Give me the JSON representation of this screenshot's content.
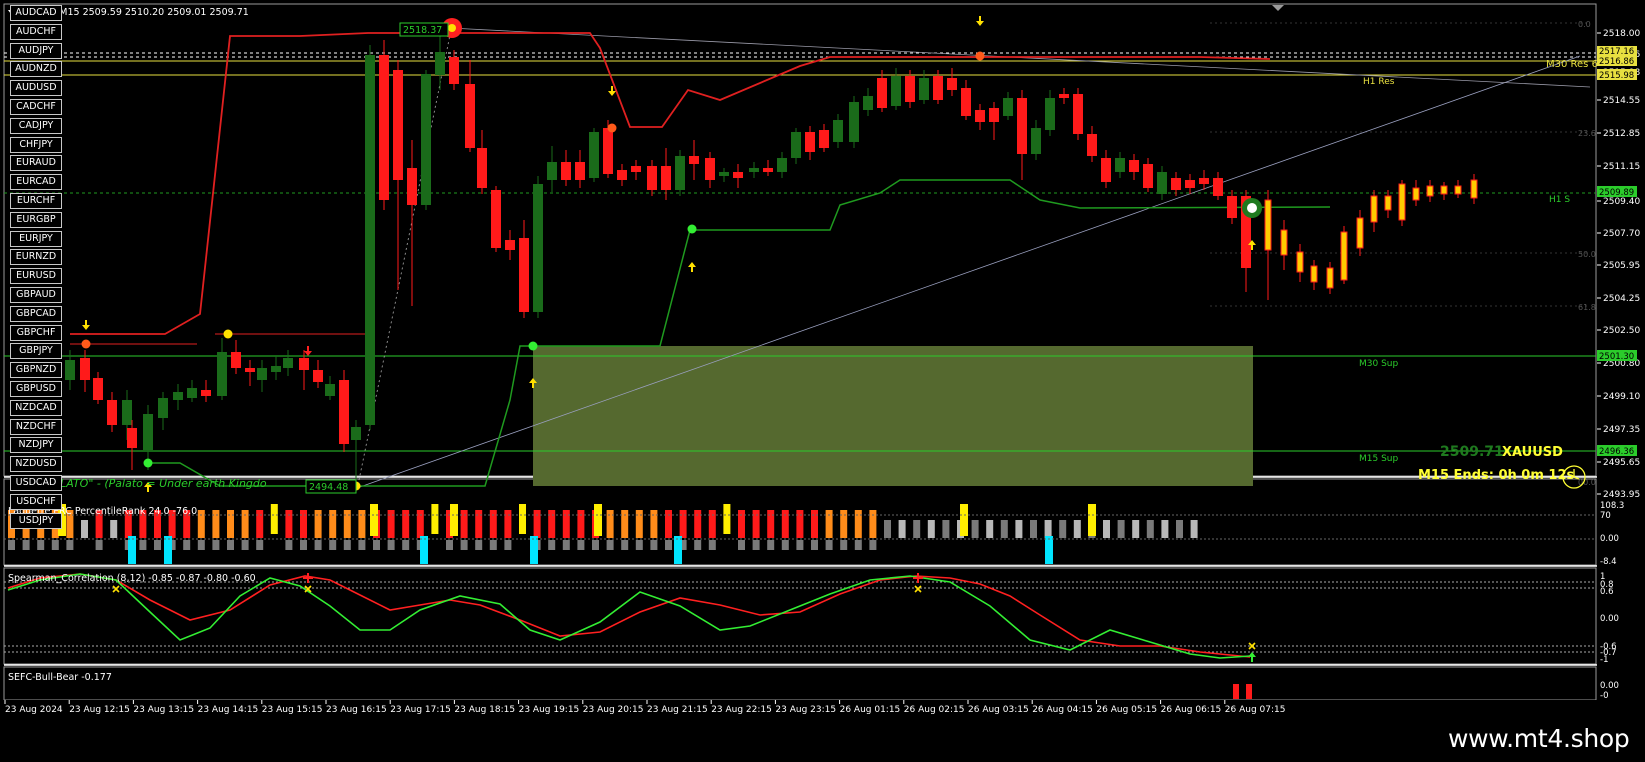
{
  "symbol_line": "XAUUSD,M15  2509.59 2510.20 2509.01 2509.71",
  "pairs": [
    "AUDCAD",
    "AUDCHF",
    "AUDJPY",
    "AUDNZD",
    "AUDUSD",
    "CADCHF",
    "CADJPY",
    "CHFJPY",
    "EURAUD",
    "EURCAD",
    "EURCHF",
    "EURGBP",
    "EURJPY",
    "EURNZD",
    "EURUSD",
    "GBPAUD",
    "GBPCAD",
    "GBPCHF",
    "GBPJPY",
    "GBPNZD",
    "GBPUSD",
    "NZDCAD",
    "NZDCHF",
    "NZDJPY",
    "NZDUSD",
    "USDCAD",
    "USDCHF",
    "USDJPY"
  ],
  "price_axis": [
    "2518.00",
    "2516.86",
    "2515.98",
    "2514.55",
    "2512.85",
    "2511.15",
    "2509.40",
    "2507.70",
    "2505.95",
    "2504.25",
    "2502.50",
    "2500.80",
    "2499.10",
    "2497.35",
    "2495.65",
    "2493.95"
  ],
  "price_tags": {
    "top_a": "2517.16",
    "top_b": "2516.86",
    "res": "2515.98",
    "bid": "2509.89",
    "m30sup": "2501.30",
    "m15sup": "2496.36"
  },
  "levels": {
    "m30_res": "M30 Res 6",
    "h1_res": "H1 Res",
    "h1_s": "H1 S",
    "m30_sup": "M30 Sup",
    "m15_sup": "M15 Sup"
  },
  "fib": {
    "f0": "0.0",
    "f236": "23.6",
    "f50": "50.0",
    "f618": "61.8",
    "f100": "00.0"
  },
  "annotations": {
    "high_price": "2518.37",
    "low_price": "2494.48",
    "indicator_caption": "SEFC \"PALATO\" - (Palato = Under earth Kingdo"
  },
  "status": {
    "price": "2509.71",
    "symbol": "XAUUSD",
    "timer": "M15 Ends: 0h 0m 12s"
  },
  "laguerre": {
    "title": "Laguerre PRC PercentileRank 24.0 -76.0",
    "axis": [
      "108.3",
      "70",
      "0.00",
      "-8.4"
    ]
  },
  "spearman": {
    "title": "Spearman_Correlation (8,12) -0.85 -0.87 -0.80 -0.60",
    "axis": [
      "1",
      "0.8",
      "0.6",
      "0.00",
      "-0.6",
      "-0.7",
      "-1"
    ]
  },
  "bullbear": {
    "title": "SEFC-Bull-Bear -0.177",
    "axis": [
      "0.00",
      "-0"
    ]
  },
  "time_axis": [
    "23 Aug 2024",
    "23 Aug 12:15",
    "23 Aug 13:15",
    "23 Aug 14:15",
    "23 Aug 15:15",
    "23 Aug 16:15",
    "23 Aug 17:15",
    "23 Aug 18:15",
    "23 Aug 19:15",
    "23 Aug 20:15",
    "23 Aug 21:15",
    "23 Aug 22:15",
    "23 Aug 23:15",
    "26 Aug 01:15",
    "26 Aug 02:15",
    "26 Aug 03:15",
    "26 Aug 04:15",
    "26 Aug 05:15",
    "26 Aug 06:15",
    "26 Aug 07:15"
  ],
  "watermark": "www.mt4.shop",
  "colors": {
    "bull": "#1a6b1a",
    "bear": "#ff1a1a",
    "resistance": "#e02020",
    "support": "#1f9a1f",
    "zone": "#55692f",
    "level": "#e8e040",
    "cyan": "#00e5ff",
    "orange": "#ff8c1a"
  }
}
